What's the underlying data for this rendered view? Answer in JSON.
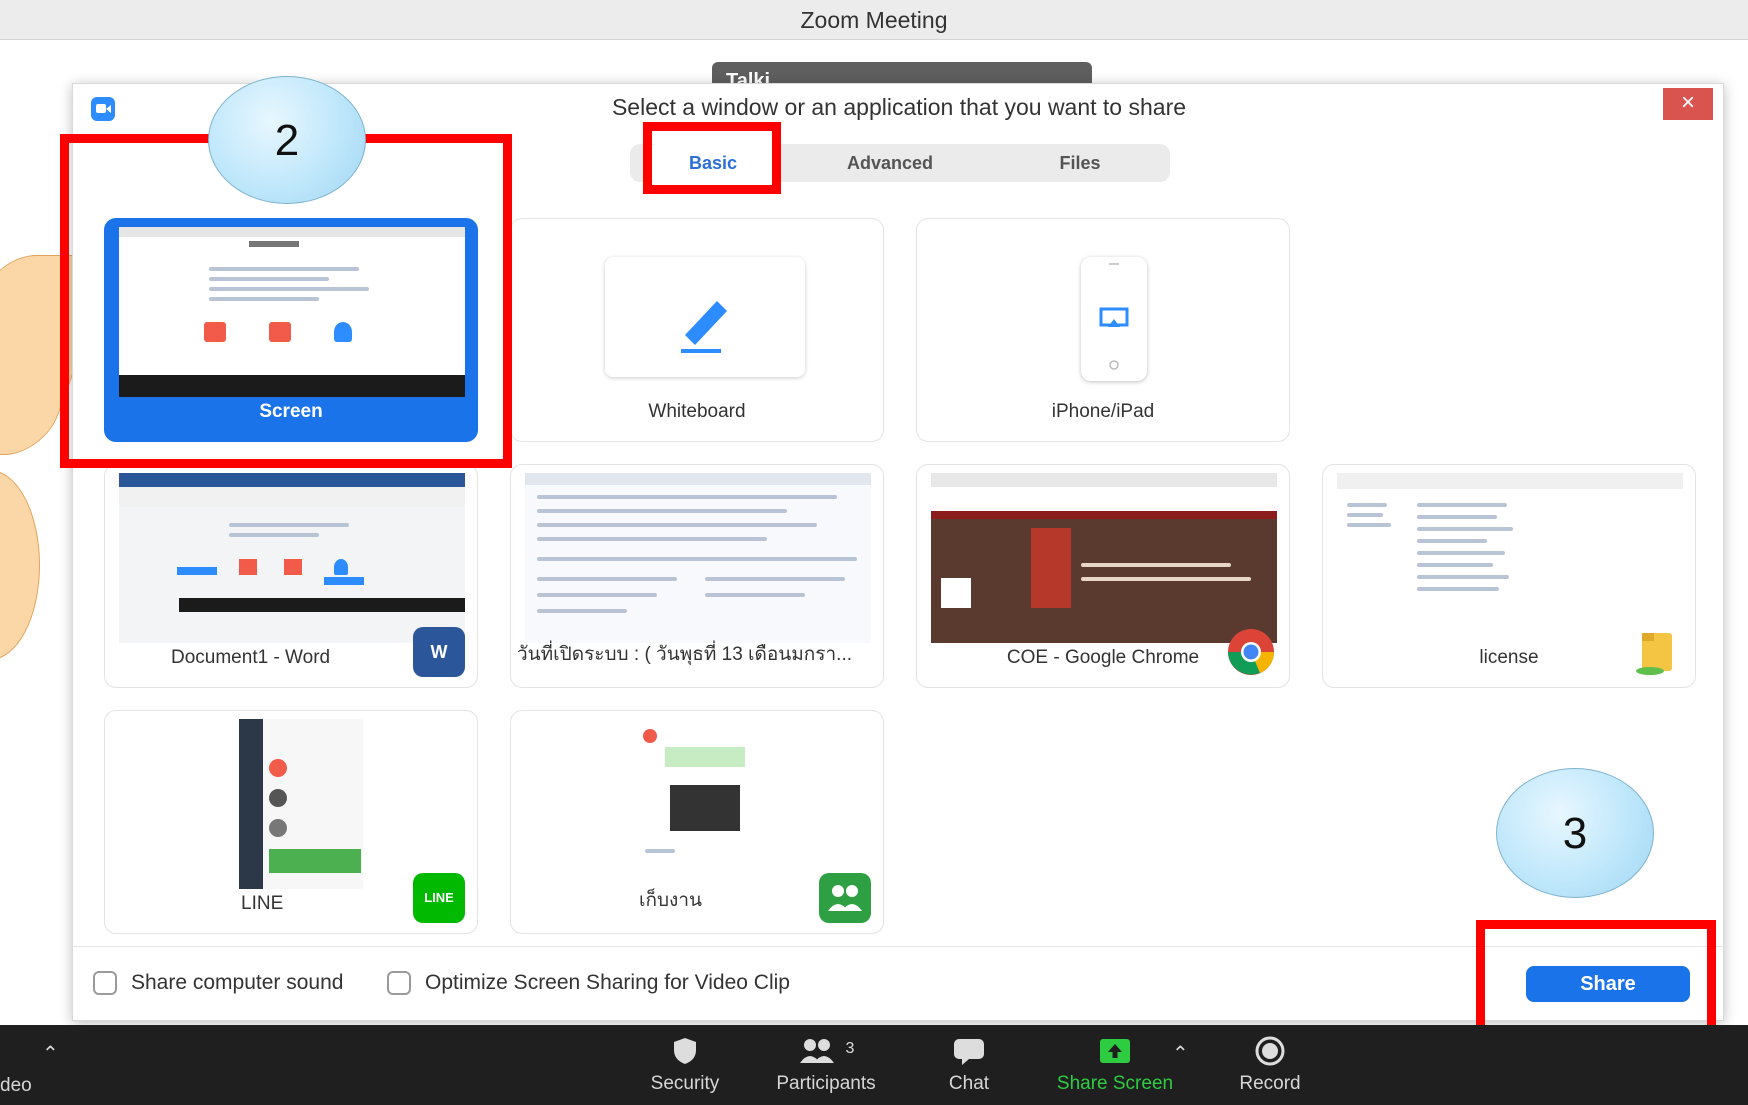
{
  "window": {
    "title": "Zoom Meeting",
    "bg_pill_text": "Talki"
  },
  "dialog": {
    "title": "Select a window or an application that you want to share",
    "close_glyph": "×",
    "tabs": [
      {
        "label": "Basic",
        "active": true
      },
      {
        "label": "Advanced",
        "active": false
      },
      {
        "label": "Files",
        "active": false
      }
    ],
    "items": [
      {
        "label": "Screen",
        "selected": true,
        "icon": "desktop-thumbnail"
      },
      {
        "label": "Whiteboard",
        "icon": "pencil-icon"
      },
      {
        "label": "iPhone/iPad",
        "icon": "airplay-icon"
      },
      {
        "label": "Document1 - Word",
        "icon": "word-icon",
        "badge": "W"
      },
      {
        "label": "วันที่เปิดระบบ : ( วันพุธที่ 13 เดือนมกรา...",
        "icon": "document-window-icon"
      },
      {
        "label": "COE - Google Chrome",
        "icon": "chrome-icon"
      },
      {
        "label": "license",
        "icon": "folder-icon"
      },
      {
        "label": "LINE",
        "icon": "line-icon",
        "badge": "LINE"
      },
      {
        "label": "เก็บงาน",
        "icon": "group-chat-icon"
      }
    ],
    "options": {
      "share_sound": "Share computer sound",
      "optimize_video": "Optimize Screen Sharing for Video Clip"
    },
    "share_button": "Share"
  },
  "annotations": {
    "step2": "2",
    "step3": "3",
    "highlight_color": "#ff0000"
  },
  "toolbar": {
    "left_partial": "deo",
    "items": [
      {
        "label": "Security",
        "icon": "shield-icon"
      },
      {
        "label": "Participants",
        "icon": "participants-icon",
        "count": "3"
      },
      {
        "label": "Chat",
        "icon": "chat-icon"
      },
      {
        "label": "Share Screen",
        "icon": "share-screen-icon"
      },
      {
        "label": "Record",
        "icon": "record-icon"
      }
    ],
    "active_color": "#2ecc40"
  }
}
